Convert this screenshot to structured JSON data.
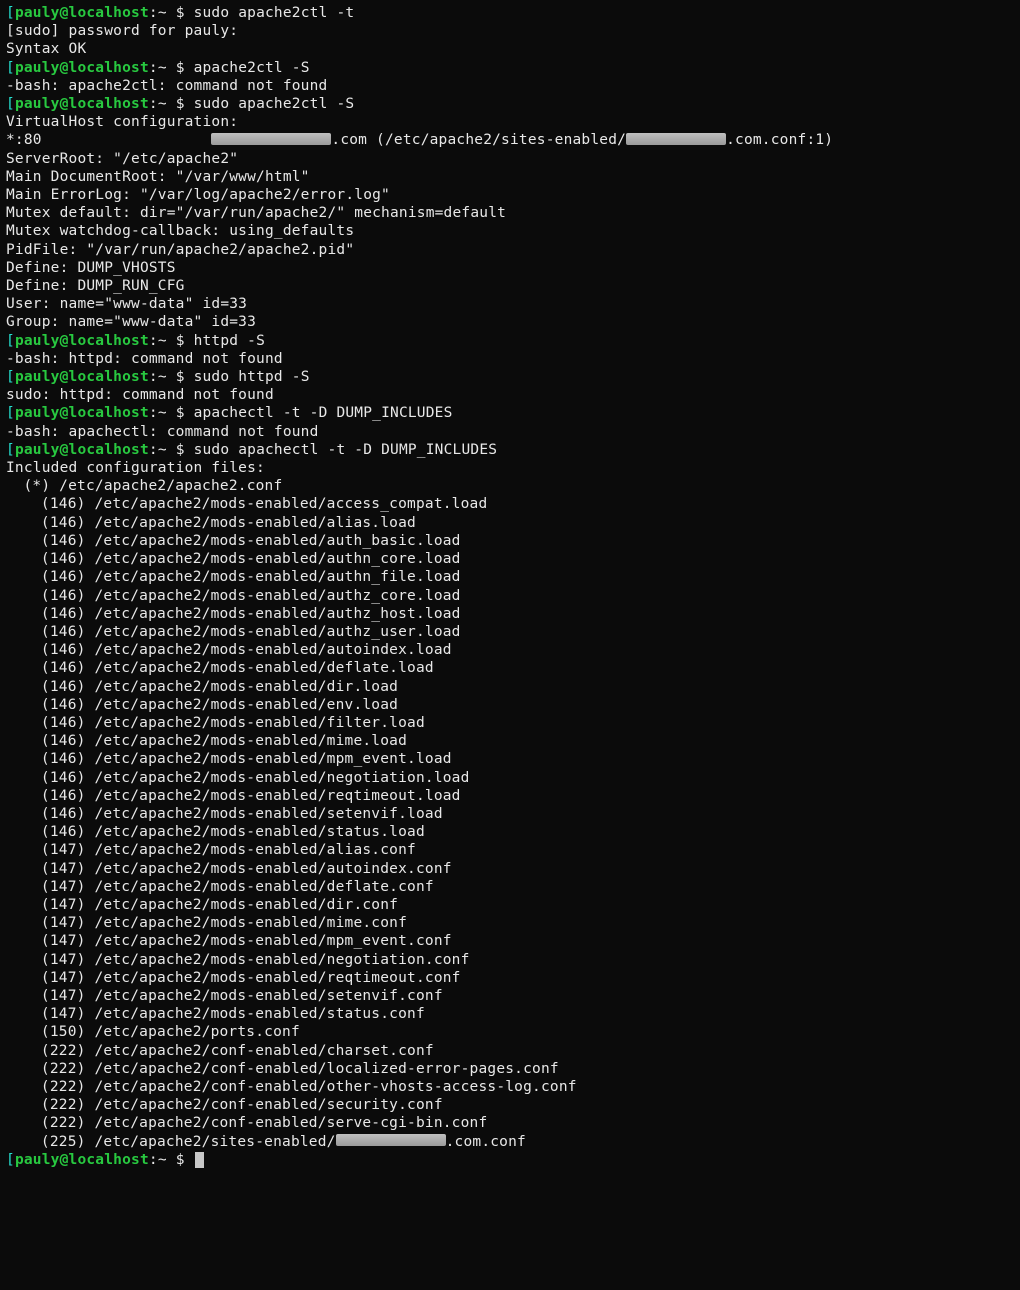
{
  "prompt": {
    "user": "pauly",
    "host": "localhost",
    "cwd": "~",
    "dollar": "$"
  },
  "session": [
    {
      "type": "prompt",
      "cmd": "sudo apache2ctl -t"
    },
    {
      "type": "out",
      "text": "[sudo] password for pauly:"
    },
    {
      "type": "out",
      "text": "Syntax OK"
    },
    {
      "type": "prompt",
      "cmd": "apache2ctl -S"
    },
    {
      "type": "out",
      "text": "-bash: apache2ctl: command not found"
    },
    {
      "type": "prompt",
      "cmd": "sudo apache2ctl -S"
    },
    {
      "type": "out",
      "text": "VirtualHost configuration:"
    },
    {
      "type": "vhost"
    },
    {
      "type": "out",
      "text": "ServerRoot: \"/etc/apache2\""
    },
    {
      "type": "out",
      "text": "Main DocumentRoot: \"/var/www/html\""
    },
    {
      "type": "out",
      "text": "Main ErrorLog: \"/var/log/apache2/error.log\""
    },
    {
      "type": "out",
      "text": "Mutex default: dir=\"/var/run/apache2/\" mechanism=default"
    },
    {
      "type": "out",
      "text": "Mutex watchdog-callback: using_defaults"
    },
    {
      "type": "out",
      "text": "PidFile: \"/var/run/apache2/apache2.pid\""
    },
    {
      "type": "out",
      "text": "Define: DUMP_VHOSTS"
    },
    {
      "type": "out",
      "text": "Define: DUMP_RUN_CFG"
    },
    {
      "type": "out",
      "text": "User: name=\"www-data\" id=33"
    },
    {
      "type": "out",
      "text": "Group: name=\"www-data\" id=33"
    },
    {
      "type": "prompt",
      "cmd": "httpd -S"
    },
    {
      "type": "out",
      "text": "-bash: httpd: command not found"
    },
    {
      "type": "prompt",
      "cmd": "sudo httpd -S"
    },
    {
      "type": "out",
      "text": "sudo: httpd: command not found"
    },
    {
      "type": "prompt",
      "cmd": "apachectl -t -D DUMP_INCLUDES"
    },
    {
      "type": "out",
      "text": "-bash: apachectl: command not found"
    },
    {
      "type": "prompt",
      "cmd": "sudo apachectl -t -D DUMP_INCLUDES"
    },
    {
      "type": "out",
      "text": "Included configuration files:"
    },
    {
      "type": "out",
      "indent": 1,
      "text": "(*) /etc/apache2/apache2.conf"
    },
    {
      "type": "out",
      "indent": 2,
      "text": "(146) /etc/apache2/mods-enabled/access_compat.load"
    },
    {
      "type": "out",
      "indent": 2,
      "text": "(146) /etc/apache2/mods-enabled/alias.load"
    },
    {
      "type": "out",
      "indent": 2,
      "text": "(146) /etc/apache2/mods-enabled/auth_basic.load"
    },
    {
      "type": "out",
      "indent": 2,
      "text": "(146) /etc/apache2/mods-enabled/authn_core.load"
    },
    {
      "type": "out",
      "indent": 2,
      "text": "(146) /etc/apache2/mods-enabled/authn_file.load"
    },
    {
      "type": "out",
      "indent": 2,
      "text": "(146) /etc/apache2/mods-enabled/authz_core.load"
    },
    {
      "type": "out",
      "indent": 2,
      "text": "(146) /etc/apache2/mods-enabled/authz_host.load"
    },
    {
      "type": "out",
      "indent": 2,
      "text": "(146) /etc/apache2/mods-enabled/authz_user.load"
    },
    {
      "type": "out",
      "indent": 2,
      "text": "(146) /etc/apache2/mods-enabled/autoindex.load"
    },
    {
      "type": "out",
      "indent": 2,
      "text": "(146) /etc/apache2/mods-enabled/deflate.load"
    },
    {
      "type": "out",
      "indent": 2,
      "text": "(146) /etc/apache2/mods-enabled/dir.load"
    },
    {
      "type": "out",
      "indent": 2,
      "text": "(146) /etc/apache2/mods-enabled/env.load"
    },
    {
      "type": "out",
      "indent": 2,
      "text": "(146) /etc/apache2/mods-enabled/filter.load"
    },
    {
      "type": "out",
      "indent": 2,
      "text": "(146) /etc/apache2/mods-enabled/mime.load"
    },
    {
      "type": "out",
      "indent": 2,
      "text": "(146) /etc/apache2/mods-enabled/mpm_event.load"
    },
    {
      "type": "out",
      "indent": 2,
      "text": "(146) /etc/apache2/mods-enabled/negotiation.load"
    },
    {
      "type": "out",
      "indent": 2,
      "text": "(146) /etc/apache2/mods-enabled/reqtimeout.load"
    },
    {
      "type": "out",
      "indent": 2,
      "text": "(146) /etc/apache2/mods-enabled/setenvif.load"
    },
    {
      "type": "out",
      "indent": 2,
      "text": "(146) /etc/apache2/mods-enabled/status.load"
    },
    {
      "type": "out",
      "indent": 2,
      "text": "(147) /etc/apache2/mods-enabled/alias.conf"
    },
    {
      "type": "out",
      "indent": 2,
      "text": "(147) /etc/apache2/mods-enabled/autoindex.conf"
    },
    {
      "type": "out",
      "indent": 2,
      "text": "(147) /etc/apache2/mods-enabled/deflate.conf"
    },
    {
      "type": "out",
      "indent": 2,
      "text": "(147) /etc/apache2/mods-enabled/dir.conf"
    },
    {
      "type": "out",
      "indent": 2,
      "text": "(147) /etc/apache2/mods-enabled/mime.conf"
    },
    {
      "type": "out",
      "indent": 2,
      "text": "(147) /etc/apache2/mods-enabled/mpm_event.conf"
    },
    {
      "type": "out",
      "indent": 2,
      "text": "(147) /etc/apache2/mods-enabled/negotiation.conf"
    },
    {
      "type": "out",
      "indent": 2,
      "text": "(147) /etc/apache2/mods-enabled/reqtimeout.conf"
    },
    {
      "type": "out",
      "indent": 2,
      "text": "(147) /etc/apache2/mods-enabled/setenvif.conf"
    },
    {
      "type": "out",
      "indent": 2,
      "text": "(147) /etc/apache2/mods-enabled/status.conf"
    },
    {
      "type": "out",
      "indent": 2,
      "text": "(150) /etc/apache2/ports.conf"
    },
    {
      "type": "out",
      "indent": 2,
      "text": "(222) /etc/apache2/conf-enabled/charset.conf"
    },
    {
      "type": "out",
      "indent": 2,
      "text": "(222) /etc/apache2/conf-enabled/localized-error-pages.conf"
    },
    {
      "type": "out",
      "indent": 2,
      "text": "(222) /etc/apache2/conf-enabled/other-vhosts-access-log.conf"
    },
    {
      "type": "out",
      "indent": 2,
      "text": "(222) /etc/apache2/conf-enabled/security.conf"
    },
    {
      "type": "out",
      "indent": 2,
      "text": "(222) /etc/apache2/conf-enabled/serve-cgi-bin.conf"
    },
    {
      "type": "site-enabled",
      "indent": 2
    },
    {
      "type": "prompt",
      "cmd": "",
      "cursor": true
    }
  ],
  "vhost_line": {
    "prefix": "*:80                   ",
    "after_smudge1": ".com (/etc/apache2/sites-enabled/",
    "after_smudge2": ".com.conf:1)"
  },
  "site_enabled_line": {
    "prefix": "(225) /etc/apache2/sites-enabled/",
    "suffix": ".com.conf"
  }
}
